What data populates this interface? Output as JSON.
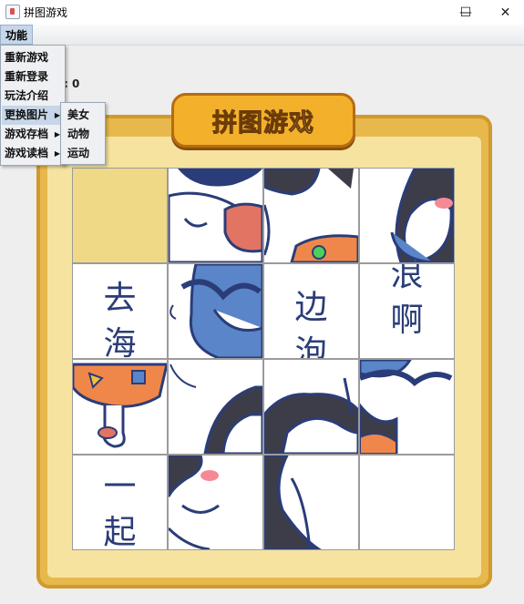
{
  "window": {
    "title": "拼图游戏",
    "minimize_glyph": "—",
    "maximize_glyph": "☐",
    "close_glyph": "✕"
  },
  "menu": {
    "function_label": "功能",
    "items": [
      "重新游戏",
      "重新登录",
      "玩法介绍",
      "更换图片",
      "游戏存档",
      "游戏读档"
    ],
    "submenu": [
      "美女",
      "动物",
      "运动"
    ]
  },
  "game": {
    "step_label": ": 0",
    "logo_text": "拼图游戏"
  },
  "tiles": {
    "r1c0": [
      "去",
      "海"
    ],
    "r1c2": [
      "边",
      "泡"
    ],
    "r1c3": [
      "浪",
      "啊"
    ],
    "r3c0": [
      "一",
      "起"
    ]
  },
  "colors": {
    "frame": "#e7b84c",
    "empty_tile": "#efd987",
    "menu_highlight": "#c7d6e8"
  }
}
